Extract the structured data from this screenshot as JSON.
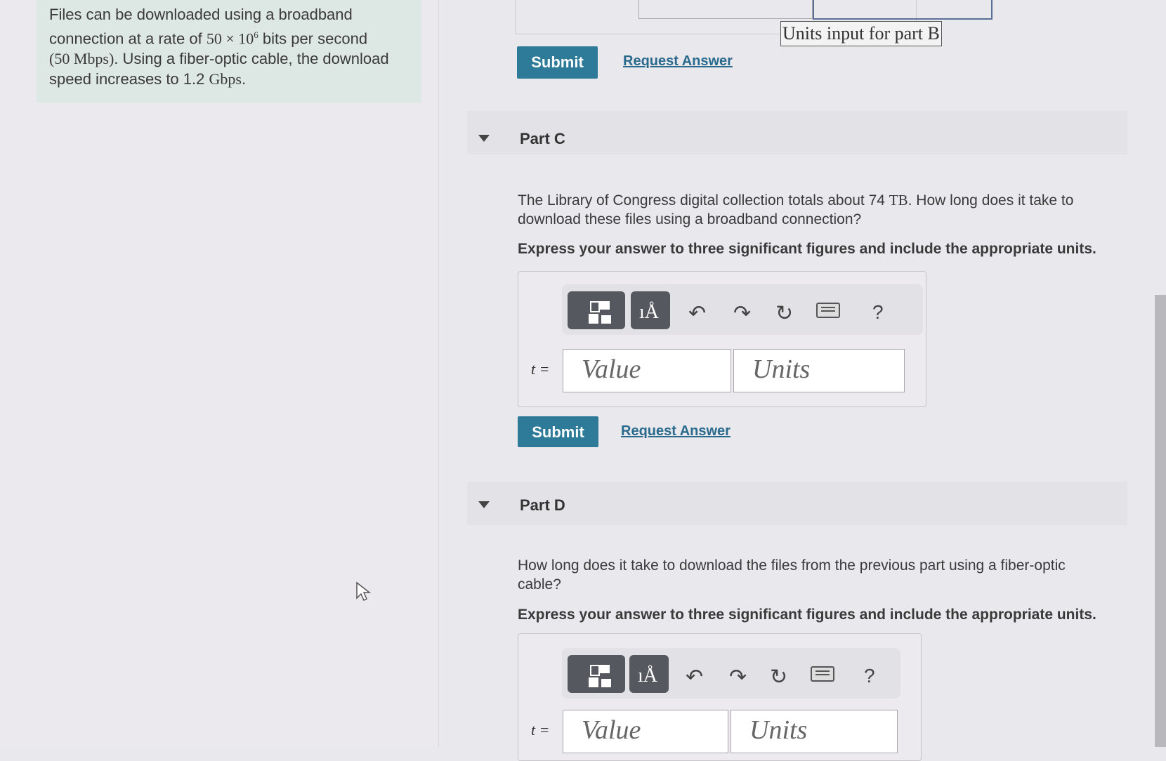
{
  "intro": {
    "line1": "Files can be downloaded using a broadband",
    "line2_pre": "connection at a rate of ",
    "rate_base": "50 × 10",
    "rate_exp": "6",
    "line2_post": " bits per second",
    "line3_mbps": "(50 Mbps)",
    "line3_post": ". Using a fiber-optic cable, the download",
    "line4_pre": "speed increases to 1.2 ",
    "line4_unit": "Gbps",
    "line4_post": "."
  },
  "part_b": {
    "units_tooltip": "Units input for part B",
    "submit_label": "Submit",
    "request_label": "Request Answer"
  },
  "part_c": {
    "title": "Part C",
    "question_pre": "The Library of Congress digital collection totals about 74 ",
    "question_unit": "TB",
    "question_post": ". How long does it take to download these files using a broadband connection?",
    "instruction": "Express your answer to three significant figures and include the appropriate units.",
    "var_label": "t =",
    "value_placeholder": "Value",
    "units_placeholder": "Units",
    "submit_label": "Submit",
    "request_label": "Request Answer"
  },
  "part_d": {
    "title": "Part D",
    "question": "How long does it take to download the files from the previous part using a fiber-optic cable?",
    "instruction": "Express your answer to three significant figures and include the appropriate units.",
    "var_label": "t =",
    "value_placeholder": "Value",
    "units_placeholder": "Units"
  },
  "toolbar": {
    "template_icon": "template-icon",
    "units_icon": "units-icon",
    "units_glyph": "ıÅ",
    "undo_icon": "undo-icon",
    "redo_icon": "redo-icon",
    "reset_icon": "reset-icon",
    "keyboard_icon": "keyboard-icon",
    "help_label": "?"
  },
  "colors": {
    "accent": "#2d7a99",
    "link": "#2a6a8d",
    "intro_bg": "#dde7e4"
  }
}
